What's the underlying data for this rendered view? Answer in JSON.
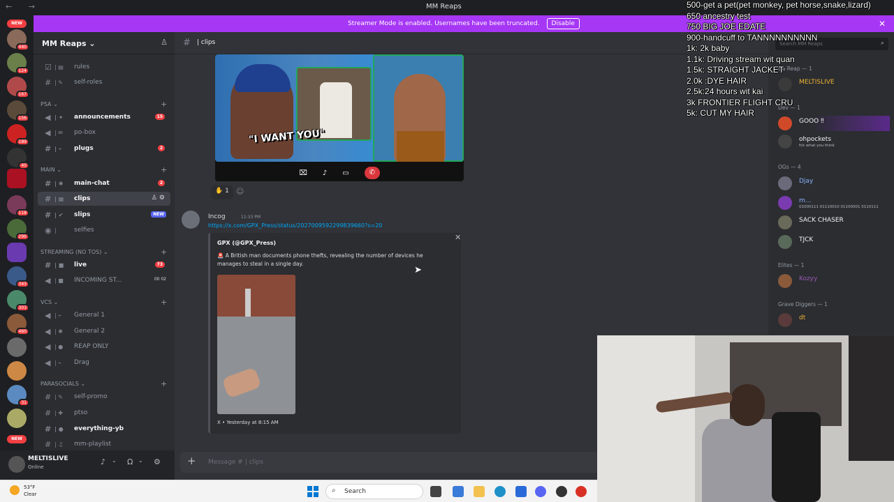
{
  "window": {
    "title": "MM Reaps",
    "nav_arrows": "← →"
  },
  "banner": {
    "text": "Streamer Mode is enabled. Usernames have been truncated.",
    "button": "Disable",
    "close": "✕"
  },
  "rail": {
    "new_label": "NEW",
    "badges": [
      "440",
      "124",
      "167",
      "156",
      "189",
      "40",
      "118",
      "296",
      "343",
      "303",
      "460",
      "31"
    ]
  },
  "server": {
    "name": "MM Reaps ⌄"
  },
  "categories": {
    "psa": "PSA ⌄",
    "main": "MAIN ⌄",
    "streaming": "STREAMING (NO TOS) ⌄",
    "vcs": "VCs ⌄",
    "parasocials": "PARASOCIALS ⌄"
  },
  "channels": {
    "rules": "rules",
    "self_roles": "self-roles",
    "announcements": "announcements",
    "announcements_count": "15",
    "po_box": "po-box",
    "plugs": "plugs",
    "plugs_count": "2",
    "main_chat": "main-chat",
    "main_chat_count": "2",
    "clips": "clips",
    "slips": "slips",
    "slips_badge": "NEW",
    "selfies": "selfies",
    "live": "live",
    "live_count": "73",
    "incoming": "INCOMING ST...",
    "incoming_counts": "00 02",
    "general1": "General 1",
    "general2": "General 2",
    "reap_only": "REAP ONLY",
    "drag": "Drag",
    "self_promo": "self-promo",
    "ptso": "ptso",
    "everything_yb": "everything-yb",
    "mm_playlist": "mm-playlist"
  },
  "user": {
    "name": "MELTISLIVE",
    "status": "Online"
  },
  "header": {
    "channel": "| clips"
  },
  "clip": {
    "caption": "\"I WANT YOU\""
  },
  "reaction": {
    "emoji": "✋",
    "count": "1"
  },
  "message": {
    "author": "Incog",
    "time": "11:33 PM",
    "link": "https://x.com/GPX_Press/status/2027009592299839660?s=20",
    "embed_author": "GPX (@GPX_Press)",
    "embed_text": "🚨 A British man documents phone thefts, revealing the number of devices he manages to steal in a single day.",
    "embed_footer": "X • Yesterday at 8:15 AM"
  },
  "composer": {
    "placeholder": "Message # | clips"
  },
  "members": {
    "search": "Search MM Reaps",
    "cat_reap": "Da Reap — 1",
    "m1": "MELTISLIVE",
    "cat2": "Dev — 1",
    "m2": "GOOO ‼",
    "m3": "ohpockets",
    "m3_status": "fck what you think",
    "cat_ogs": "OGs — 4",
    "m4": "Djay",
    "m5": "m...",
    "m5_status": "01000111 01110010 01100001 0110111",
    "m6": "SACK CHASER",
    "m7": "TJCK",
    "cat_elites": "Elites — 1",
    "m8": "Kozyy",
    "cat_grave": "Grave Diggers — 1",
    "m9": "dt"
  },
  "goals": [
    "500-get a pet(pet monkey, pet horse,snake,lizard)",
    "650 ancestry test",
    "750 BIG JOE EDATE",
    "900-handcuff to TANNNNNNNNNN",
    "1k: 2k baby",
    "1.1k: Driving stream wit quan",
    "1.5k: STRAIGHT JACKET",
    "2.0k :DYE HAIR",
    "2.5k:24 hours wit kai",
    "3k FRONTIER FLIGHT CRU",
    "5k: CUT MY HAIR"
  ],
  "taskbar": {
    "temp": "53°F",
    "cond": "Clear",
    "search": "Search"
  },
  "colors": {
    "accent": "#a637f5",
    "mention": "#f23f42",
    "link": "#00a8fc",
    "online": "#23a55a"
  }
}
